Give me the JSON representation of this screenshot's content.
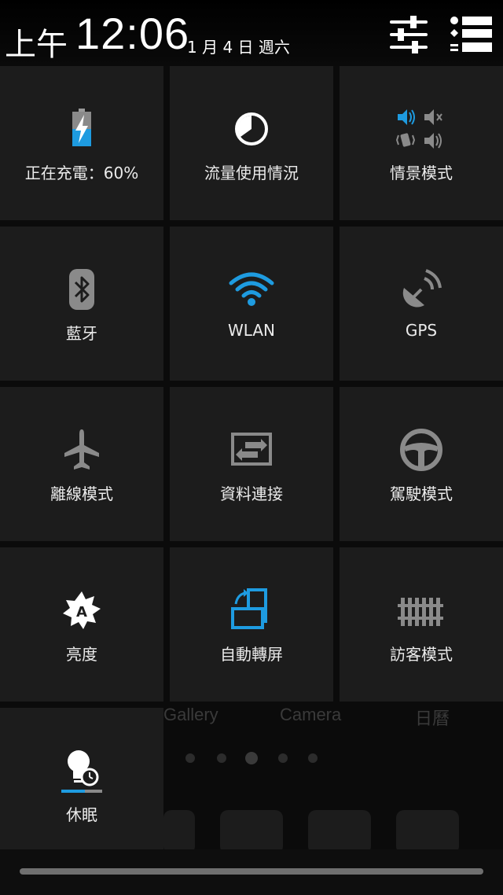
{
  "status_bar": {
    "ampm": "上午",
    "time": "12:06",
    "date": "1 月 4 日 週六"
  },
  "header_buttons": {
    "settings_icon": "sliders-icon",
    "list_icon": "list-icon"
  },
  "background_labels": [
    "Gallery",
    "Camera",
    "日曆"
  ],
  "tiles": [
    {
      "label": "正在充電：60%",
      "icon": "battery-charging-icon"
    },
    {
      "label": "流量使用情況",
      "icon": "data-usage-icon"
    },
    {
      "label": "情景模式",
      "icon": "sound-profile-icon"
    },
    {
      "label": "藍牙",
      "icon": "bluetooth-icon"
    },
    {
      "label": "WLAN",
      "icon": "wifi-icon"
    },
    {
      "label": "GPS",
      "icon": "gps-icon"
    },
    {
      "label": "離線模式",
      "icon": "airplane-icon"
    },
    {
      "label": "資料連接",
      "icon": "data-connection-icon"
    },
    {
      "label": "駕駛模式",
      "icon": "steering-wheel-icon"
    },
    {
      "label": "亮度",
      "icon": "brightness-auto-icon"
    },
    {
      "label": "自動轉屏",
      "icon": "auto-rotate-icon"
    },
    {
      "label": "訪客模式",
      "icon": "fence-icon"
    },
    {
      "label": "休眠",
      "icon": "sleep-icon"
    }
  ],
  "colors": {
    "accent": "#1e9be0",
    "inactive": "#8a8a8a",
    "tile_bg": "#1c1c1c"
  }
}
